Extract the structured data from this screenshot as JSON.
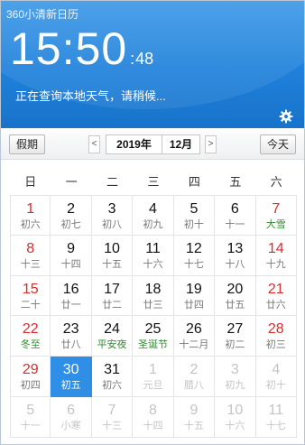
{
  "header": {
    "app_title": "360小清新日历",
    "clock_hm": "15:50",
    "clock_sec": "48",
    "status": "正在查询本地天气，请稍候..."
  },
  "toolbar": {
    "holiday_label": "假期",
    "prev_label": "<",
    "next_label": ">",
    "year": "2019年",
    "month": "12月",
    "today_label": "今天"
  },
  "weekdays": [
    "日",
    "一",
    "二",
    "三",
    "四",
    "五",
    "六"
  ],
  "colors": {
    "header_blue": "#2a87de",
    "today_bg": "#2f8fe6",
    "weekend_red": "#d82c2c",
    "festival_green": "#2e8b2e",
    "other_month_grey": "#c4c4c4"
  },
  "days": [
    {
      "d": "1",
      "l": "初六",
      "wk": true
    },
    {
      "d": "2",
      "l": "初七"
    },
    {
      "d": "3",
      "l": "初八"
    },
    {
      "d": "4",
      "l": "初九"
    },
    {
      "d": "5",
      "l": "初十"
    },
    {
      "d": "6",
      "l": "十一"
    },
    {
      "d": "7",
      "l": "大雪",
      "wk": true,
      "festival": true
    },
    {
      "d": "8",
      "l": "十三",
      "wk": true
    },
    {
      "d": "9",
      "l": "十四"
    },
    {
      "d": "10",
      "l": "十五"
    },
    {
      "d": "11",
      "l": "十六"
    },
    {
      "d": "12",
      "l": "十七"
    },
    {
      "d": "13",
      "l": "十八"
    },
    {
      "d": "14",
      "l": "十九",
      "wk": true
    },
    {
      "d": "15",
      "l": "二十",
      "wk": true
    },
    {
      "d": "16",
      "l": "廿一"
    },
    {
      "d": "17",
      "l": "廿二"
    },
    {
      "d": "18",
      "l": "廿三"
    },
    {
      "d": "19",
      "l": "廿四"
    },
    {
      "d": "20",
      "l": "廿五"
    },
    {
      "d": "21",
      "l": "廿六",
      "wk": true
    },
    {
      "d": "22",
      "l": "冬至",
      "wk": true,
      "festival": true
    },
    {
      "d": "23",
      "l": "廿八"
    },
    {
      "d": "24",
      "l": "平安夜",
      "festival": true
    },
    {
      "d": "25",
      "l": "圣诞节",
      "festival": true
    },
    {
      "d": "26",
      "l": "十二月"
    },
    {
      "d": "27",
      "l": "初二"
    },
    {
      "d": "28",
      "l": "初三",
      "wk": true
    },
    {
      "d": "29",
      "l": "初四",
      "wk": true
    },
    {
      "d": "30",
      "l": "初五",
      "today": true
    },
    {
      "d": "31",
      "l": "初六"
    },
    {
      "d": "1",
      "l": "元旦",
      "other": true
    },
    {
      "d": "2",
      "l": "腊八",
      "other": true
    },
    {
      "d": "3",
      "l": "初九",
      "other": true
    },
    {
      "d": "4",
      "l": "初十",
      "other": true
    },
    {
      "d": "5",
      "l": "十一",
      "other": true
    },
    {
      "d": "6",
      "l": "小寒",
      "other": true
    },
    {
      "d": "7",
      "l": "十三",
      "other": true
    },
    {
      "d": "8",
      "l": "十四",
      "other": true
    },
    {
      "d": "9",
      "l": "十五",
      "other": true
    },
    {
      "d": "10",
      "l": "十六",
      "other": true
    },
    {
      "d": "11",
      "l": "十七",
      "other": true
    }
  ]
}
